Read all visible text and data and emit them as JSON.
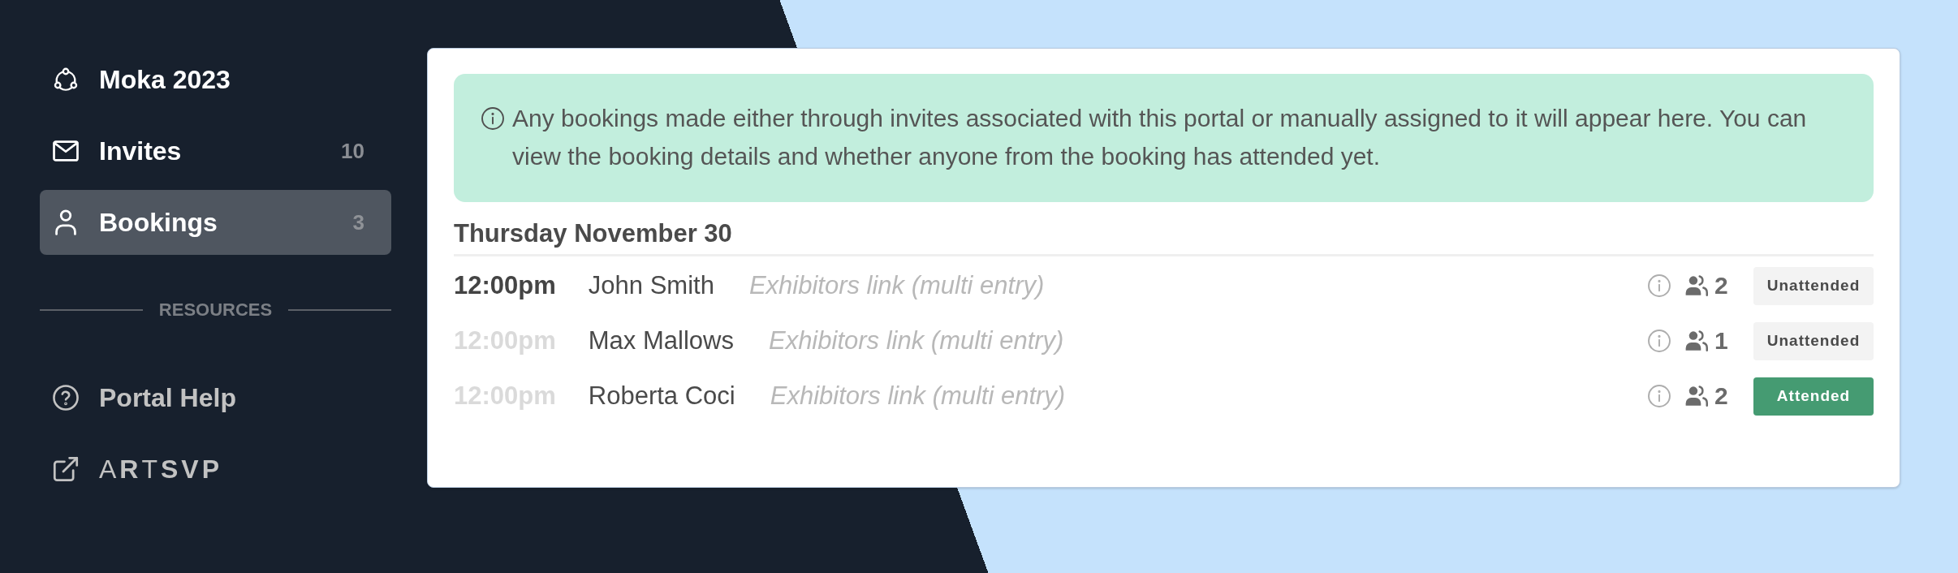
{
  "sidebar": {
    "items": [
      {
        "label": "Moka 2023",
        "selected": false
      },
      {
        "label": "Invites",
        "count": "10",
        "selected": false
      },
      {
        "label": "Bookings",
        "count": "3",
        "selected": true
      }
    ],
    "section_heading": "RESOURCES",
    "resource_links": [
      {
        "kind": "help",
        "label": "Portal Help"
      },
      {
        "kind": "wordmark",
        "label": "A**R**T**SVP**"
      }
    ]
  },
  "bookings_panel": {
    "notice": "Any bookings made either through invites associated with this portal or manually assigned to it will appear here. You can view the booking details and whether anyone from the booking has attended yet.",
    "date_heading": "Thursday November 30",
    "rows": [
      {
        "time": "12:00pm",
        "dimmed": false,
        "name": "John Smith",
        "source": "Exhibitors link (multi entry)",
        "guests": "2",
        "status": "Unattended",
        "attended": false
      },
      {
        "time": "12:00pm",
        "dimmed": true,
        "name": "Max Mallows",
        "source": "Exhibitors link (multi entry)",
        "guests": "1",
        "status": "Unattended",
        "attended": false
      },
      {
        "time": "12:00pm",
        "dimmed": true,
        "name": "Roberta Coci",
        "source": "Exhibitors link (multi entry)",
        "guests": "2",
        "status": "Attended",
        "attended": true
      }
    ]
  }
}
